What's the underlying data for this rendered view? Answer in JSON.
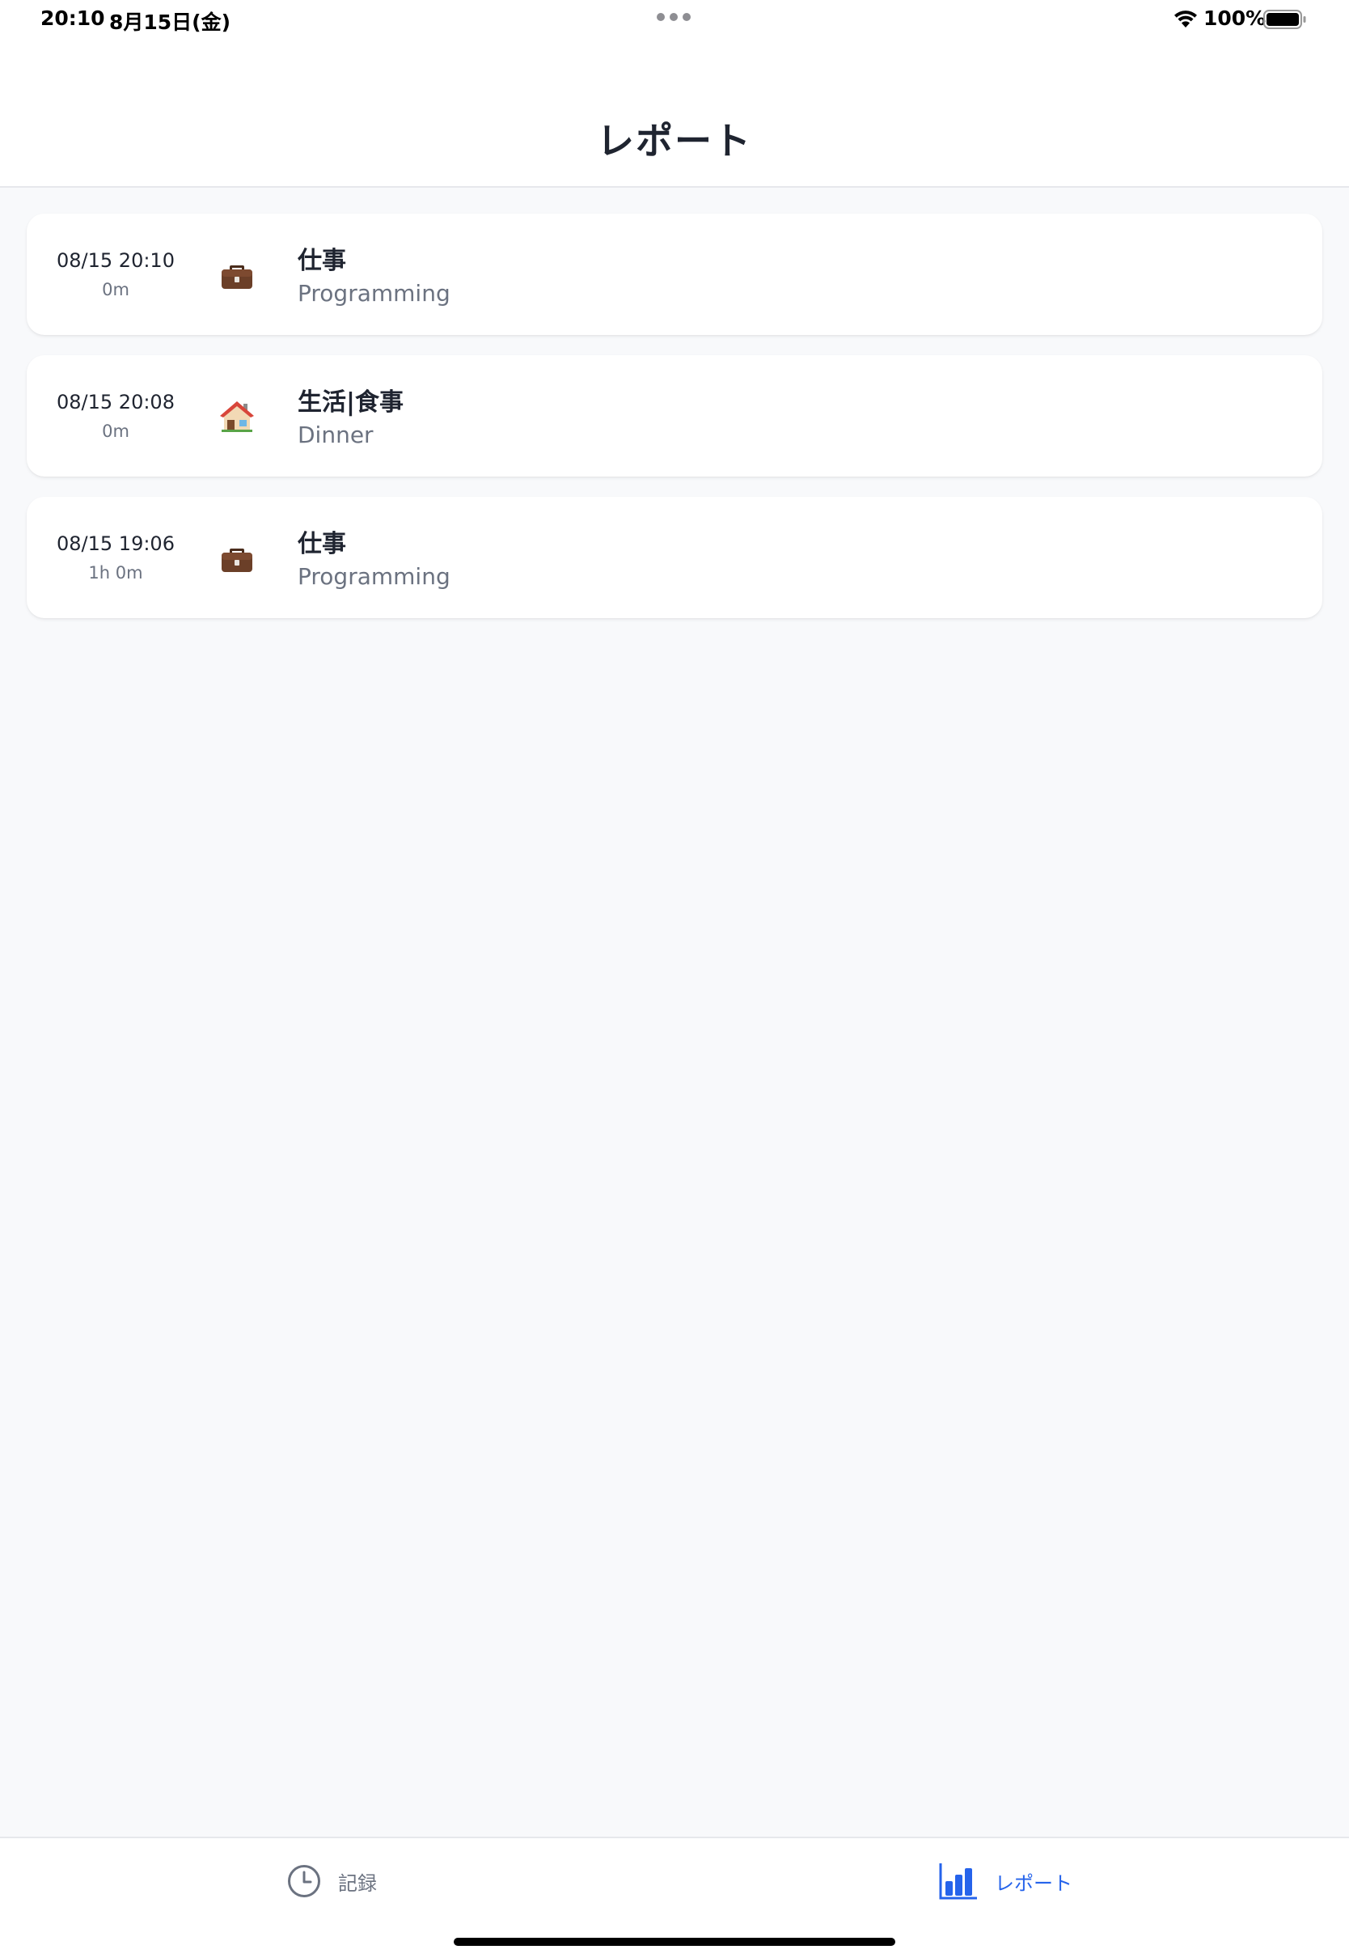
{
  "status_bar": {
    "time": "20:10",
    "date": "8月15日(金)",
    "battery": "100%"
  },
  "header": {
    "title": "レポート"
  },
  "entries": [
    {
      "datetime": "08/15 20:10",
      "duration": "0m",
      "icon": "briefcase-icon",
      "category": "仕事",
      "task": "Programming"
    },
    {
      "datetime": "08/15 20:08",
      "duration": "0m",
      "icon": "house-icon",
      "category": "生活|食事",
      "task": "Dinner"
    },
    {
      "datetime": "08/15 19:06",
      "duration": "1h 0m",
      "icon": "briefcase-icon",
      "category": "仕事",
      "task": "Programming"
    }
  ],
  "tab_bar": {
    "tabs": [
      {
        "label": "記録",
        "icon": "clock-icon",
        "active": false
      },
      {
        "label": "レポート",
        "icon": "bar-chart-icon",
        "active": true
      }
    ]
  },
  "colors": {
    "accent": "#2563eb",
    "background": "#f8f9fb",
    "card": "#ffffff",
    "muted_text": "#6b7280"
  }
}
